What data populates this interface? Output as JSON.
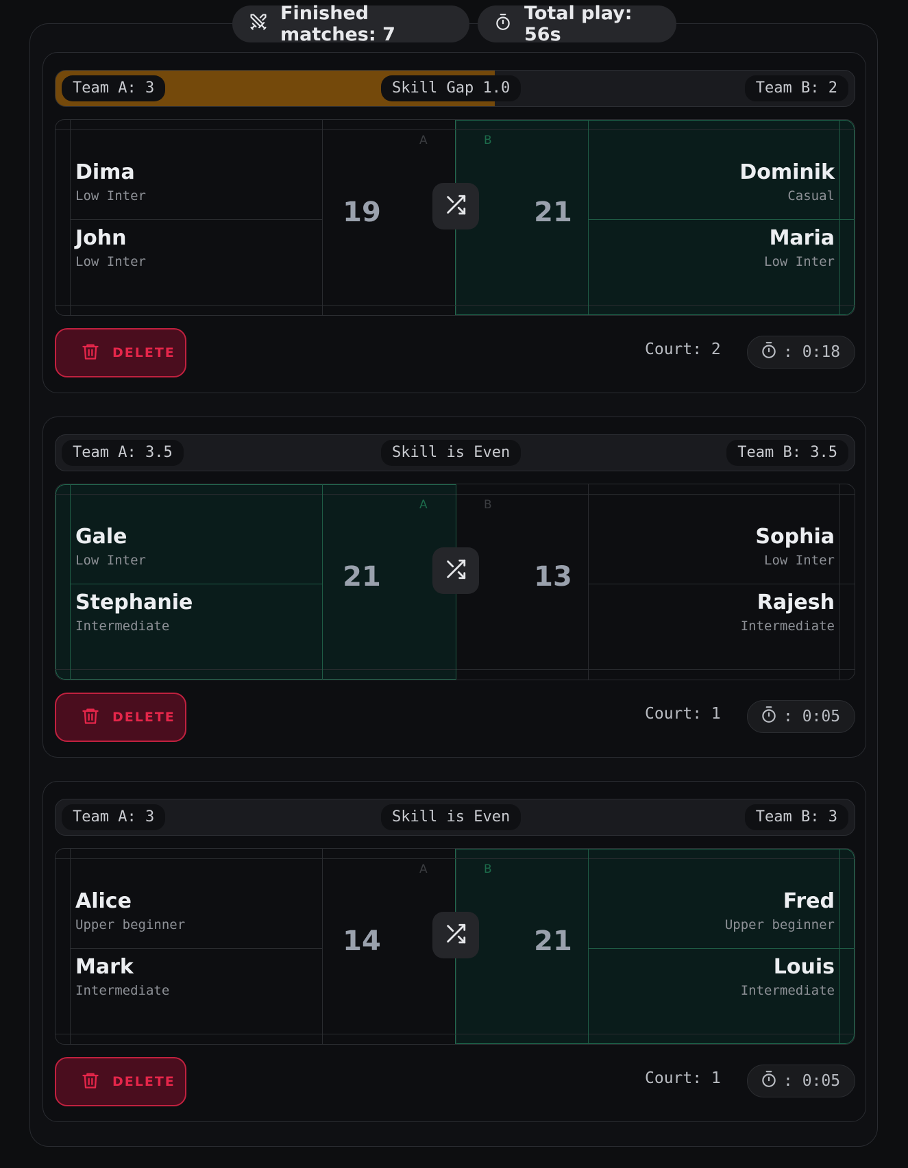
{
  "header": {
    "finished_matches_label": "Finished matches: 7",
    "finished_icon": "crossed-swords-icon",
    "total_play_label": "Total play:  56s",
    "total_icon": "stopwatch-icon"
  },
  "colors": {
    "winner_fill": "#0a1c1b",
    "winner_border": "#1f6a4e",
    "skill_gap_fill": "#74490b",
    "delete_red": "#e5264a"
  },
  "matches": [
    {
      "team_a_label": "Team A: 3",
      "team_b_label": "Team B: 2",
      "skill_label": "Skill Gap 1.0",
      "skill_gap_fraction": 0.55,
      "side_a": "A",
      "side_b": "B",
      "winner": "B",
      "score_a": "19",
      "score_b": "21",
      "team_a_players": [
        {
          "name": "Dima",
          "level": "Low Inter"
        },
        {
          "name": "John",
          "level": "Low Inter"
        }
      ],
      "team_b_players": [
        {
          "name": "Dominik",
          "level": "Casual"
        },
        {
          "name": "Maria",
          "level": "Low Inter"
        }
      ],
      "delete_label": "DELETE",
      "court_label": "Court: 2",
      "duration_label": ": 0:18"
    },
    {
      "team_a_label": "Team A: 3.5",
      "team_b_label": "Team B: 3.5",
      "skill_label": "Skill is Even",
      "skill_gap_fraction": 0,
      "side_a": "A",
      "side_b": "B",
      "winner": "A",
      "score_a": "21",
      "score_b": "13",
      "team_a_players": [
        {
          "name": "Gale",
          "level": "Low Inter"
        },
        {
          "name": "Stephanie",
          "level": "Intermediate"
        }
      ],
      "team_b_players": [
        {
          "name": "Sophia",
          "level": "Low Inter"
        },
        {
          "name": "Rajesh",
          "level": "Intermediate"
        }
      ],
      "delete_label": "DELETE",
      "court_label": "Court: 1",
      "duration_label": ": 0:05"
    },
    {
      "team_a_label": "Team A: 3",
      "team_b_label": "Team B: 3",
      "skill_label": "Skill is Even",
      "skill_gap_fraction": 0,
      "side_a": "A",
      "side_b": "B",
      "winner": "B",
      "score_a": "14",
      "score_b": "21",
      "team_a_players": [
        {
          "name": "Alice",
          "level": "Upper beginner"
        },
        {
          "name": "Mark",
          "level": "Intermediate"
        }
      ],
      "team_b_players": [
        {
          "name": "Fred",
          "level": "Upper beginner"
        },
        {
          "name": "Louis",
          "level": "Intermediate"
        }
      ],
      "delete_label": "DELETE",
      "court_label": "Court: 1",
      "duration_label": ": 0:05"
    }
  ]
}
